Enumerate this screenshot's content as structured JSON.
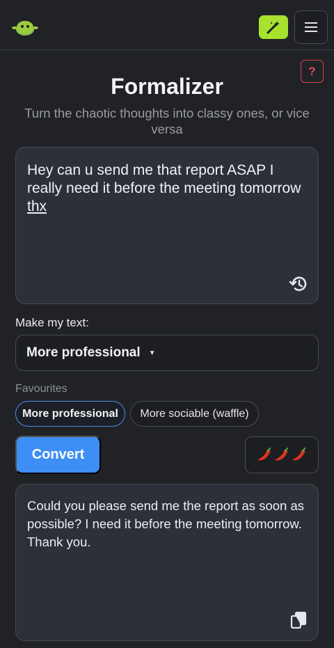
{
  "header": {
    "logo_icon": "alien-logo-icon",
    "magic_icon": "magic-wand-icon",
    "menu_icon": "hamburger-menu-icon",
    "accent_color": "#a6e22e"
  },
  "help": {
    "label": "?"
  },
  "page": {
    "title": "Formalizer",
    "subtitle": "Turn the chaotic thoughts into classy ones, or vice versa"
  },
  "input": {
    "value_main": "Hey can u send me that report ASAP I really need it before the meeting tomorrow ",
    "value_underlined": "thx",
    "history_icon": "history-icon"
  },
  "transform": {
    "label": "Make my text:",
    "selected": "More professional"
  },
  "favourites": {
    "label": "Favourites",
    "chips": [
      "More professional",
      "More sociable (waffle)"
    ]
  },
  "actions": {
    "convert_label": "Convert",
    "spiciness": 3,
    "primary_color": "#3d8ef5"
  },
  "output": {
    "value": "Could you please send me the report as soon as possible? I need it before the meeting tomorrow. Thank you.",
    "copy_icon": "copy-icon"
  }
}
